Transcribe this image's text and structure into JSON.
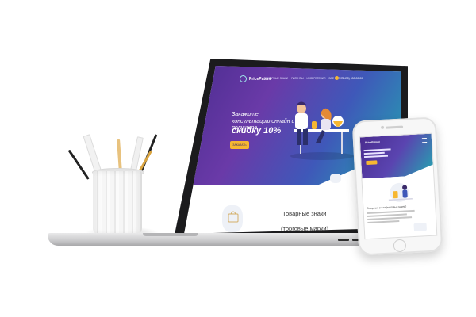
{
  "colors": {
    "hero_start": "#4a2c8f",
    "hero_mid": "#3f58b9",
    "hero_end": "#22a8b0",
    "accent": "#f6b731",
    "device_frame": "#1b1b1d"
  },
  "site": {
    "brand": "PricePatent",
    "nav_links": [
      "ТОВАРНЫЕ ЗНАКИ",
      "ПАТЕНТЫ",
      "ИЗОБРЕТЕНИЯ",
      "ВСЕ УСЛУГИ"
    ],
    "phone": "+7(495) 000-00-00",
    "hero": {
      "title": "Закажите консультацию онлайн и получите",
      "highlight": "скидку 10%",
      "button_label": "ЗАКАЗАТЬ"
    },
    "section": {
      "title": "Товарные знаки",
      "subtitle": "(торговые марки),"
    }
  },
  "mobile": {
    "brand": "PricePatent",
    "heading": "Товарные знаки (торговые марки)"
  },
  "icons": [
    "pen-cup-icon",
    "person-illustration-icon",
    "phone-icon",
    "menu-icon"
  ]
}
